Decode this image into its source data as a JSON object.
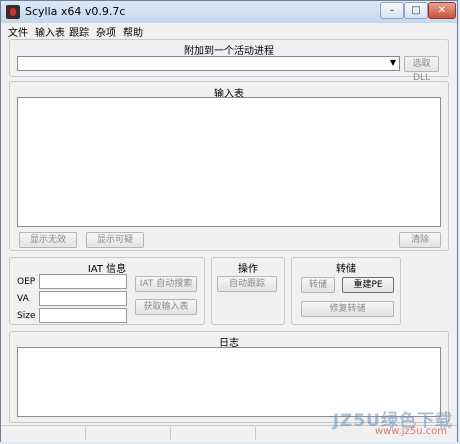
{
  "window": {
    "title": "Scylla x64 v0.9.7c",
    "min_glyph": "–",
    "max_glyph": "□",
    "close_glyph": "✕"
  },
  "menu": [
    "文件",
    "输入表",
    "跟踪",
    "杂项",
    "帮助"
  ],
  "attach": {
    "label": "附加到一个活动进程",
    "process_value": "",
    "pick_dll_button": "选取DLL"
  },
  "imports": {
    "label": "输入表",
    "show_invalid_button": "显示无效",
    "show_suspect_button": "显示可疑",
    "clear_button": "清除"
  },
  "iat": {
    "label": "IAT 信息",
    "oep_label": "OEP",
    "va_label": "VA",
    "size_label": "Size",
    "oep_value": "",
    "va_value": "",
    "size_value": "",
    "iat_autosearch_button": "IAT 自动搜索",
    "get_imports_button": "获取输入表"
  },
  "actions": {
    "label": "操作",
    "autotrace_button": "自动跟踪"
  },
  "dump": {
    "label": "转储",
    "dump_button": "转储",
    "pe_rebuild_button": "重建PE",
    "fix_dump_button": "修复转储"
  },
  "log": {
    "label": "日志"
  },
  "watermark": {
    "text": "JZ5U绿色下载",
    "subtext": "www.jz5u.com"
  },
  "colors": {
    "titlebar": "#c6d8ee",
    "window_bg": "#f0f0f0",
    "disabled_text": "#8a8a8a"
  }
}
